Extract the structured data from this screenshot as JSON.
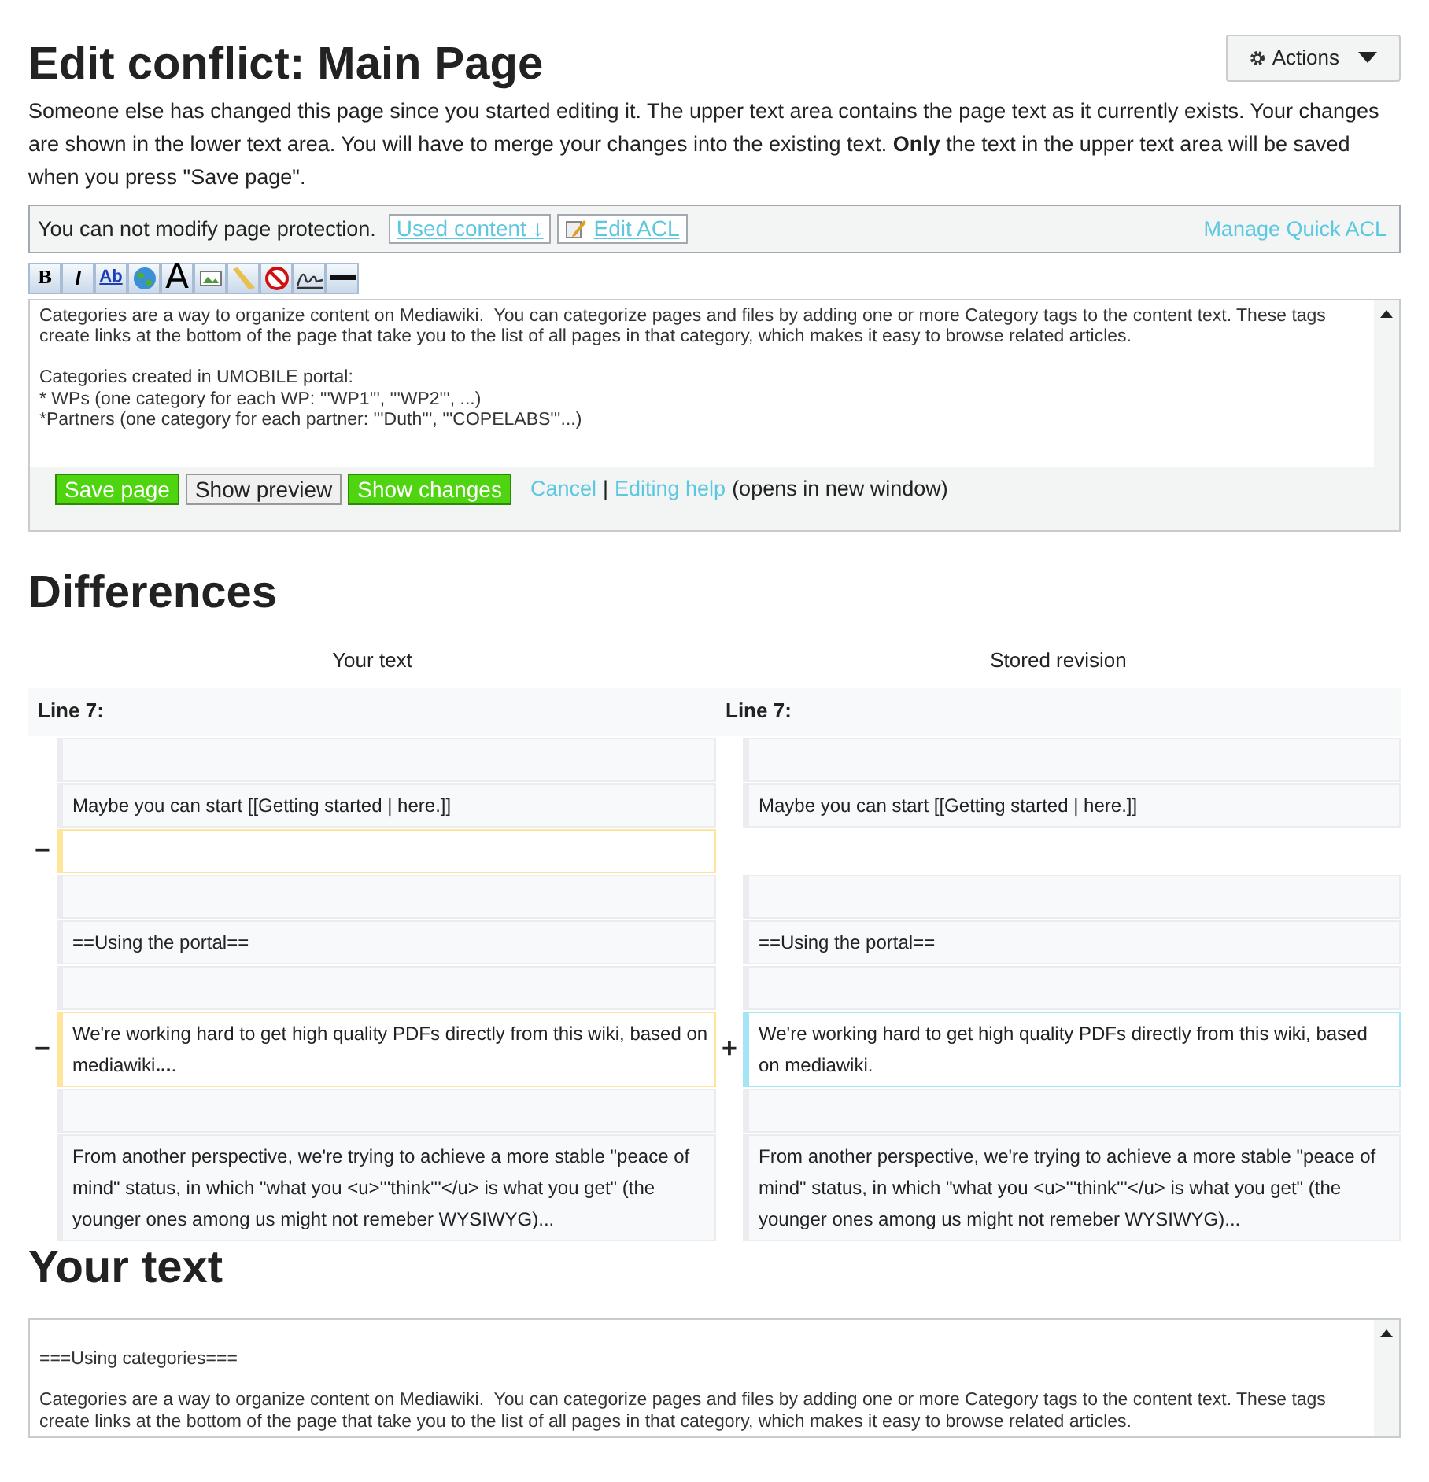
{
  "title": "Edit conflict: Main Page",
  "actions_button": {
    "label": "Actions"
  },
  "intro": "Someone else has changed this page since you started editing it. The upper text area contains the page text as it currently exists. Your changes are shown in the lower text area. You will have to merge your changes into the existing text. **Only** the text in the upper text area will be saved when you press \"Save page\".",
  "acl_bar": {
    "message": "You can not modify page protection.",
    "used_content": "Used content ↓",
    "edit_acl": "Edit ACL",
    "manage_link": "Manage Quick ACL"
  },
  "toolbar": [
    {
      "kind": "bold",
      "label": "B"
    },
    {
      "kind": "italic",
      "label": "I"
    },
    {
      "kind": "link",
      "label": "Ab"
    },
    {
      "kind": "globe"
    },
    {
      "kind": "headline",
      "label": "A"
    },
    {
      "kind": "image"
    },
    {
      "kind": "media"
    },
    {
      "kind": "nowiki"
    },
    {
      "kind": "signature"
    },
    {
      "kind": "rule"
    }
  ],
  "editor": {
    "text": "Categories are a way to organize content on Mediawiki.  You can categorize pages and files by adding one or more Category tags to the content text. These tags create links at the bottom of the page that take you to the list of all pages in that category, which makes it easy to browse related articles.\n\nCategories created in UMOBILE portal:\n* WPs (one category for each WP: '''WP1''', '''WP2''', ...)\n*Partners (one category for each partner: '''Duth''', '''COPELABS'''...)"
  },
  "form_buttons": [
    {
      "kind": "primary",
      "label": "Save page"
    },
    {
      "kind": "secondary",
      "label": "Show preview"
    },
    {
      "kind": "primary",
      "label": "Show changes"
    }
  ],
  "cancel_link": "Cancel",
  "separator": "|",
  "help_link": "Editing help",
  "help_note": "(opens in new window)",
  "differences": {
    "heading": "Differences",
    "left_title": "Your text",
    "right_title": "Stored revision",
    "left_line": "Line 7:",
    "right_line": "Line 7:",
    "rows": [
      {
        "left": {
          "kind": "context"
        },
        "right": {
          "kind": "context"
        }
      },
      {
        "left": {
          "kind": "context",
          "text": "Maybe you can start [[Getting started | here.]]"
        },
        "right": {
          "kind": "context",
          "text": "Maybe you can start [[Getting started | here.]]"
        }
      },
      {
        "left": {
          "kind": "deleted",
          "marker": "−"
        },
        "right": {
          "kind": "none"
        }
      },
      {
        "left": {
          "kind": "context"
        },
        "right": {
          "kind": "context"
        }
      },
      {
        "left": {
          "kind": "context",
          "text": "==Using the portal=="
        },
        "right": {
          "kind": "context",
          "text": "==Using the portal=="
        }
      },
      {
        "left": {
          "kind": "context"
        },
        "right": {
          "kind": "context"
        }
      },
      {
        "left": {
          "kind": "deleted",
          "marker": "−",
          "text": "We're working hard to get high quality PDFs directly from this wiki, based on mediawiki**...**."
        },
        "right": {
          "kind": "added",
          "marker": "+",
          "text": "We're working hard to get high quality PDFs directly from this wiki, based on mediawiki."
        }
      },
      {
        "left": {
          "kind": "context"
        },
        "right": {
          "kind": "context"
        }
      },
      {
        "left": {
          "kind": "context",
          "text": "From another perspective, we're trying to achieve a more stable \"peace of mind\" status, in which \"what you <u>'''think'''</u> is what you get\" (the younger ones among us might not remeber WYSIWYG)..."
        },
        "right": {
          "kind": "context",
          "text": "From another perspective, we're trying to achieve a more stable \"peace of mind\" status, in which \"what you <u>'''think'''</u> is what you get\" (the younger ones among us might not remeber WYSIWYG)..."
        }
      }
    ]
  },
  "your_text": {
    "heading": "Your text",
    "text": "\n===Using categories===\n\nCategories are a way to organize content on Mediawiki.  You can categorize pages and files by adding one or more Category tags to the content text. These tags create links at the bottom of the page that take you to the list of all pages in that category, which makes it easy to browse related articles."
  }
}
